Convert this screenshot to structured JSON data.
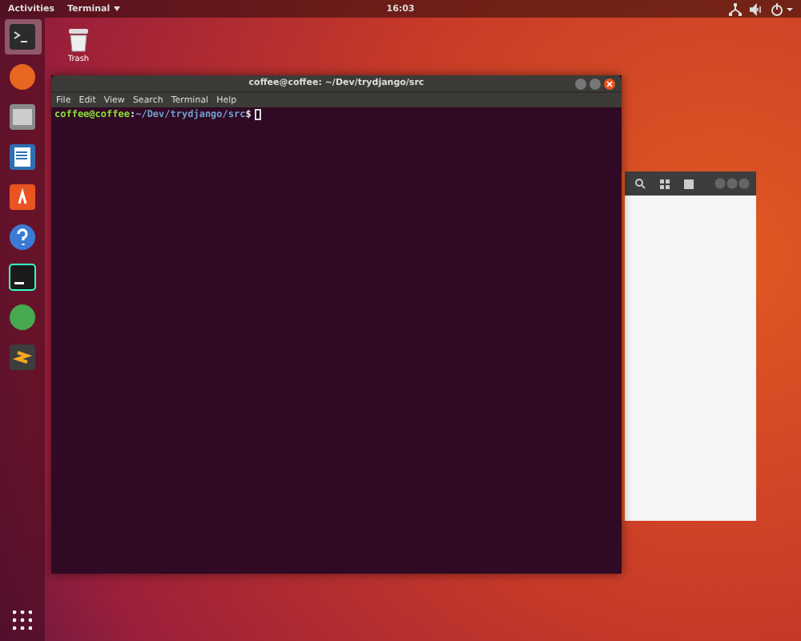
{
  "top_bar": {
    "activities": "Activities",
    "app_menu": "Terminal",
    "clock": "16:03"
  },
  "desktop_icons": [
    {
      "kind": "trash",
      "label": "Trash"
    }
  ],
  "dock": [
    {
      "kind": "terminal",
      "selected": true
    },
    {
      "kind": "browser",
      "selected": false
    },
    {
      "kind": "files",
      "selected": false
    },
    {
      "kind": "document",
      "selected": false
    },
    {
      "kind": "store",
      "selected": false
    },
    {
      "kind": "help",
      "selected": false
    },
    {
      "kind": "ide",
      "selected": false
    },
    {
      "kind": "globe",
      "selected": false
    },
    {
      "kind": "editor",
      "selected": false
    }
  ],
  "terminal_window": {
    "title": "coffee@coffee: ~/Dev/trydjango/src",
    "menu": [
      "File",
      "Edit",
      "View",
      "Search",
      "Terminal",
      "Help"
    ],
    "prompt": {
      "user": "coffee@coffee",
      "separator": ":",
      "path": "~/Dev/trydjango/src",
      "symbol": "$"
    }
  }
}
